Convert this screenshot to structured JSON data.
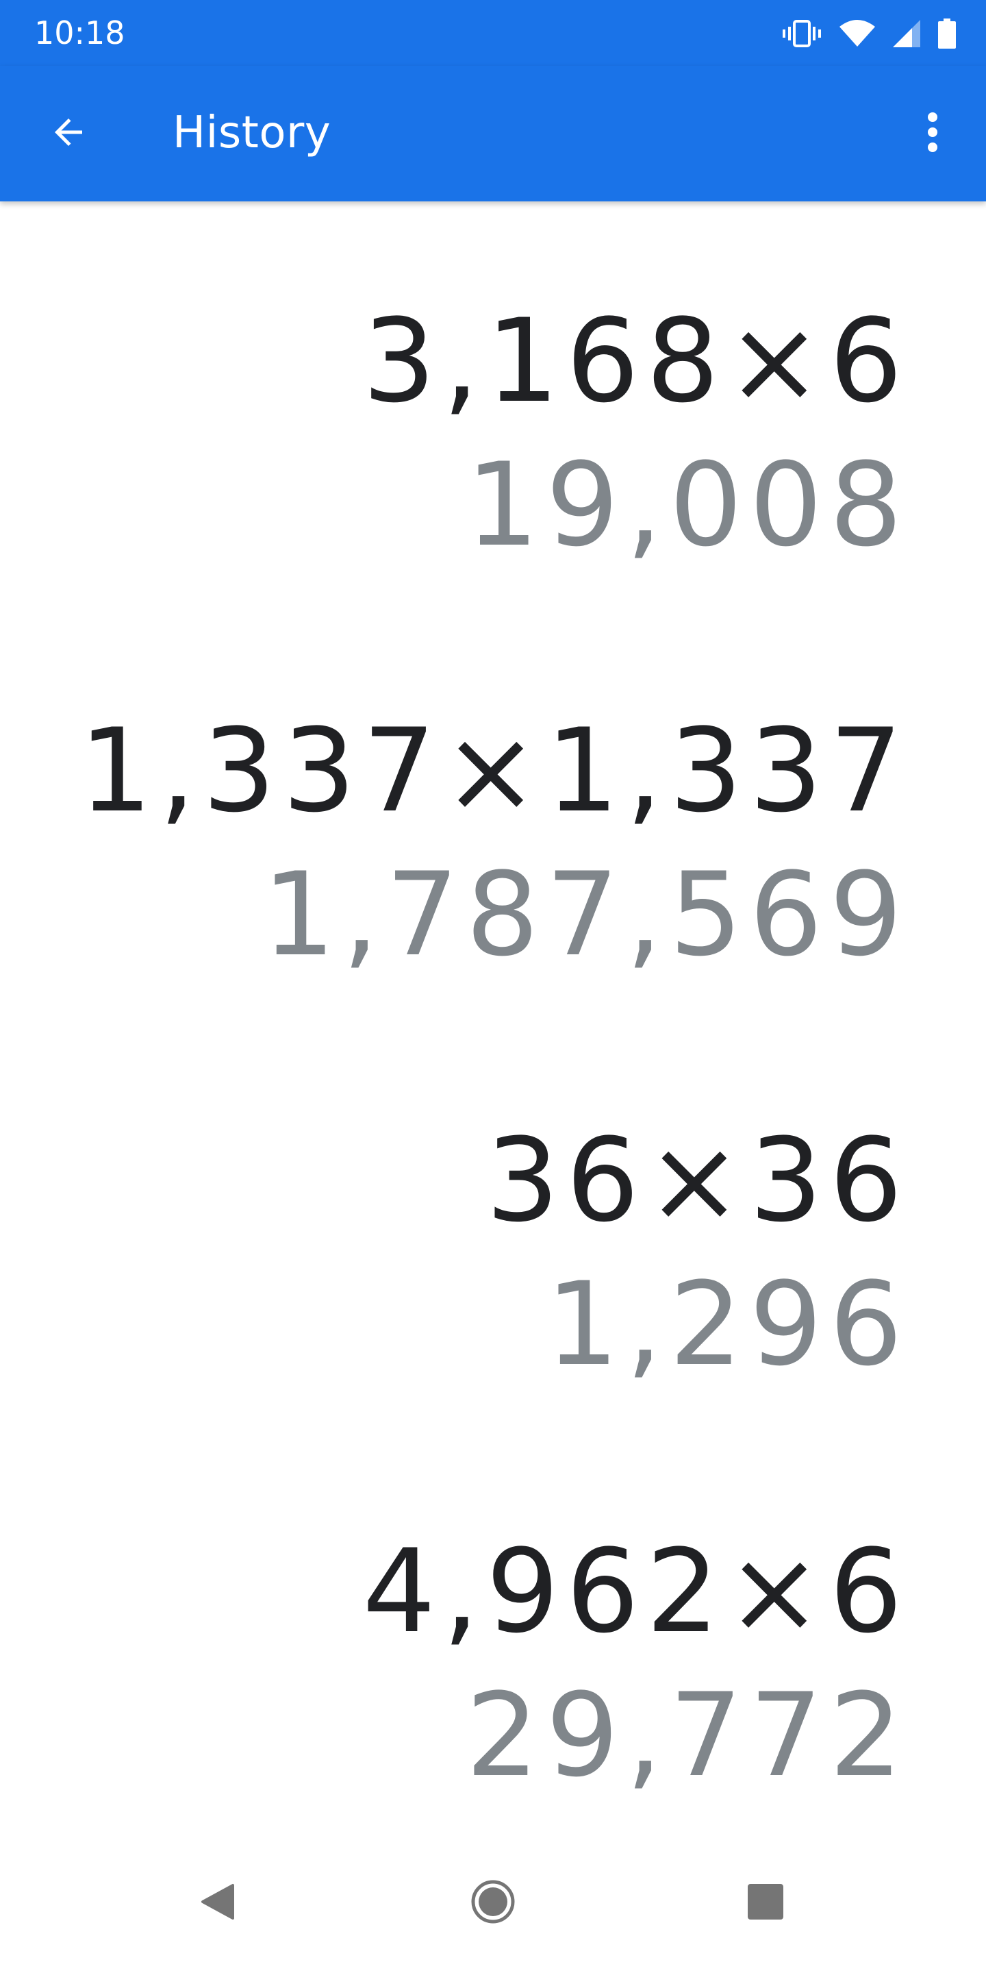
{
  "status_bar": {
    "time": "10:18",
    "icons": [
      "vibrate-icon",
      "wifi-icon",
      "cell-signal-icon",
      "battery-icon"
    ]
  },
  "app_bar": {
    "title": "History",
    "back_icon": "arrow-back-icon",
    "menu_icon": "more-vert-icon"
  },
  "history": [
    {
      "expression": "3,168×6",
      "result": "19,008"
    },
    {
      "expression": "1,337×1,337",
      "result": "1,787,569"
    },
    {
      "expression": "36×36",
      "result": "1,296"
    },
    {
      "expression": "4,962×6",
      "result": "29,772"
    }
  ],
  "nav_bar": {
    "icons": [
      "back-triangle-icon",
      "home-circle-icon",
      "recents-square-icon"
    ]
  },
  "colors": {
    "primary": "#1a73e8",
    "expression_text": "#202124",
    "result_text": "#80868b",
    "nav_icon": "#757575"
  }
}
